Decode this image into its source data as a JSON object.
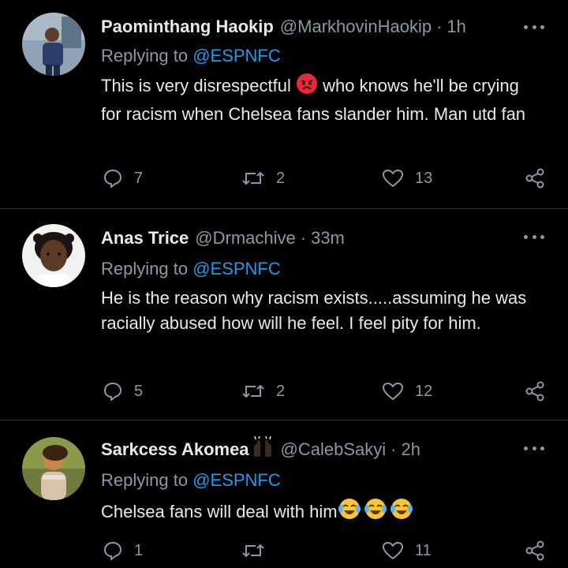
{
  "tweets": [
    {
      "name": "Paominthang Haokip",
      "handle": "@MarkhovinHaokip",
      "separator": "·",
      "time": "1h",
      "replying_prefix": "Replying to ",
      "replying_to": "@ESPNFC",
      "text_a": "This is very disrespectful ",
      "emoji_a": "angry-face-emoji",
      "text_b": " who knows he'll be crying for racism when Chelsea fans slander him. Man utd fan",
      "replies": "7",
      "retweets": "2",
      "likes": "13"
    },
    {
      "name": "Anas Trice",
      "handle": "@Drmachive",
      "separator": "·",
      "time": "33m",
      "replying_prefix": "Replying to ",
      "replying_to": "@ESPNFC",
      "text": "He is the reason why racism exists.....assuming he was racially abused how will he feel. I feel pity for him.",
      "replies": "5",
      "retweets": "2",
      "likes": "12"
    },
    {
      "name": "Sarkcess Akomea",
      "name_emoji": "raising-hands-emoji",
      "handle": "@CalebSakyi",
      "separator": "·",
      "time": "2h",
      "replying_prefix": "Replying to ",
      "replying_to": "@ESPNFC",
      "text": "Chelsea fans will deal with him",
      "emoji_trailing": "tears-of-joy-emoji",
      "replies": "1",
      "retweets": "",
      "likes": "11"
    }
  ],
  "colors": {
    "background": "#000000",
    "text": "#e7e9ea",
    "secondary": "#8b98a5",
    "link": "#1d9bf0",
    "divider": "#2f3336"
  },
  "icons": [
    "reply-icon",
    "retweet-icon",
    "like-icon",
    "share-icon",
    "more-icon"
  ]
}
